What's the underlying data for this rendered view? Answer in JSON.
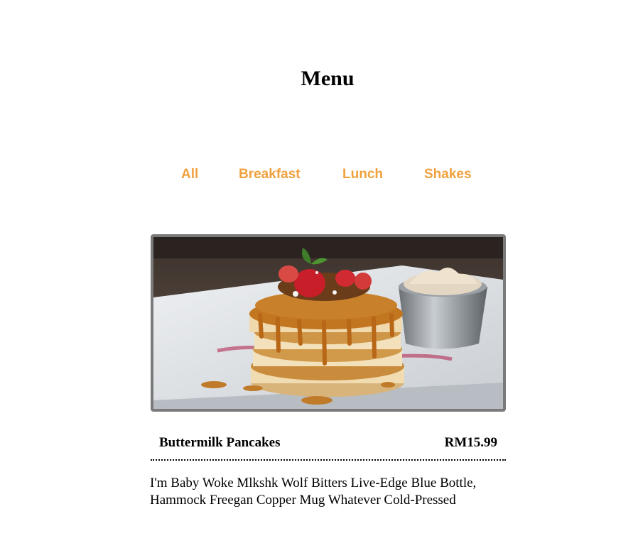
{
  "page": {
    "title": "Menu"
  },
  "filters": [
    {
      "label": "All"
    },
    {
      "label": "Breakfast"
    },
    {
      "label": "Lunch"
    },
    {
      "label": "Shakes"
    }
  ],
  "colors": {
    "filter_accent": "#f0a13e",
    "card_border": "#7a7a7a"
  },
  "menu_item": {
    "image": "pancakes-photo",
    "name": "Buttermilk Pancakes",
    "price": "RM15.99",
    "description": "I'm Baby Woke Mlkshk Wolf Bitters Live-Edge Blue Bottle, Hammock Freegan Copper Mug Whatever Cold-Pressed"
  }
}
